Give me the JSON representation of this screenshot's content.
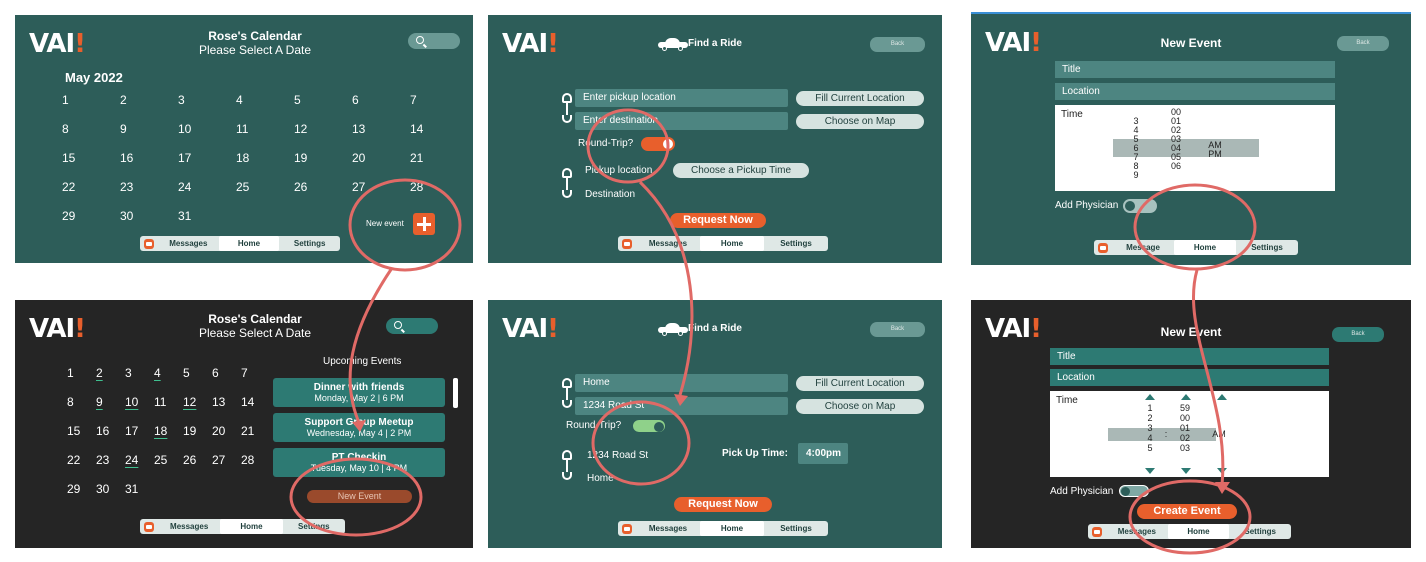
{
  "brand": {
    "logo_text": "VAI",
    "logo_bang": "!",
    "accent": "#e85f2c",
    "teal": "#2d5d59"
  },
  "panel1": {
    "title": "Rose's Calendar",
    "subtitle": "Please Select A Date",
    "month": "May 2022",
    "days": [
      "1",
      "2",
      "3",
      "4",
      "5",
      "6",
      "7",
      "8",
      "9",
      "10",
      "11",
      "12",
      "13",
      "14",
      "15",
      "16",
      "17",
      "18",
      "19",
      "20",
      "21",
      "22",
      "23",
      "24",
      "25",
      "26",
      "27",
      "28",
      "29",
      "30",
      "31"
    ],
    "new_event_label": "New event",
    "tabs": [
      "Messages",
      "Home",
      "Settings"
    ]
  },
  "panel2": {
    "title": "Find a Ride",
    "back": "Back",
    "pickup_placeholder": "Enter pickup location",
    "dest_placeholder": "Enter destination",
    "fill_current": "Fill Current Location",
    "choose_map": "Choose on Map",
    "round_trip": "Round-Trip?",
    "pickup_location": "Pickup location",
    "choose_time": "Choose a Pickup Time",
    "destination": "Destination",
    "request": "Request Now",
    "tabs": [
      "Messages",
      "Home",
      "Settings"
    ]
  },
  "panel3": {
    "title": "New Event",
    "back": "Back",
    "field_title": "Title",
    "field_location": "Location",
    "time_label": "Time",
    "hours": [
      "3",
      "4",
      "5",
      "6",
      "7",
      "8",
      "9"
    ],
    "minutes": [
      "00",
      "01",
      "02",
      "03",
      "04",
      "05",
      "06"
    ],
    "ampm": [
      "AM",
      "PM"
    ],
    "add_physician": "Add Physician",
    "tabs": [
      "Message",
      "Home",
      "Settings"
    ]
  },
  "panel4": {
    "title": "Rose's Calendar",
    "subtitle": "Please Select A Date",
    "upcoming": "Upcoming Events",
    "rows": [
      [
        "1",
        "2",
        "3",
        "4",
        "5",
        "6",
        "7"
      ],
      [
        "8",
        "9",
        "10",
        "11",
        "12",
        "13",
        "14"
      ],
      [
        "15",
        "16",
        "17",
        "18",
        "19",
        "20",
        "21"
      ],
      [
        "22",
        "23",
        "24",
        "25",
        "26",
        "27",
        "28"
      ],
      [
        "29",
        "30",
        "31"
      ]
    ],
    "events": [
      {
        "title": "Dinner with friends",
        "date": "Monday, May 2  |  6 PM"
      },
      {
        "title": "Support Group Meetup",
        "date": "Wednesday, May 4  |  2 PM"
      },
      {
        "title": "PT Checkin",
        "date": "Tuesday, May 10  |  4 PM"
      }
    ],
    "new_event": "New Event",
    "tabs": [
      "Messages",
      "Home",
      "Settings"
    ]
  },
  "panel5": {
    "title": "Find a Ride",
    "back": "Back",
    "pickup_value": "Home",
    "dest_value": "1234 Road St",
    "fill_current": "Fill Current Location",
    "choose_map": "Choose on Map",
    "round_trip": "Round-Trip?",
    "pickup_addr": "1234 Road St",
    "pickup_time_label": "Pick Up Time:",
    "pickup_time_value": "4:00pm",
    "return_dest": "Home",
    "request": "Request Now",
    "tabs": [
      "Messages",
      "Home",
      "Settings"
    ]
  },
  "panel6": {
    "title": "New Event",
    "back": "Back",
    "field_title": "Title",
    "field_location": "Location",
    "time_label": "Time",
    "hours": [
      "1",
      "2",
      "3",
      "4",
      "5"
    ],
    "minutes": [
      "59",
      "00",
      "01",
      "02",
      "03"
    ],
    "colon": ":",
    "ampm": "AM",
    "add_physician": "Add Physician",
    "create": "Create Event",
    "tabs": [
      "Messages",
      "Home",
      "Settings"
    ]
  }
}
